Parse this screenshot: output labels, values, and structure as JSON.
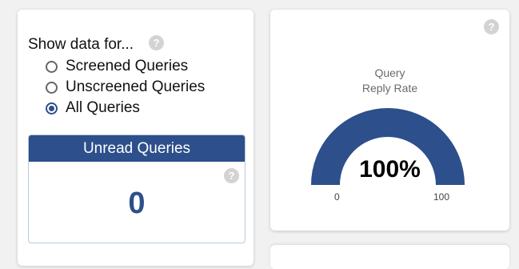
{
  "filter": {
    "label": "Show data for...",
    "help_icon": "?",
    "options": [
      {
        "label": "Screened Queries",
        "checked": false
      },
      {
        "label": "Unscreened Queries",
        "checked": false
      },
      {
        "label": "All Queries",
        "checked": true
      }
    ]
  },
  "unread": {
    "title": "Unread Queries",
    "help_icon": "?",
    "value": "0"
  },
  "gauge": {
    "title_line1": "Query",
    "title_line2": "Reply Rate",
    "help_icon": "?",
    "value_label": "100%",
    "value": 100,
    "min": "0",
    "max": "100",
    "color": "#2d4f8b",
    "track_color": "#e6e6e6"
  }
}
